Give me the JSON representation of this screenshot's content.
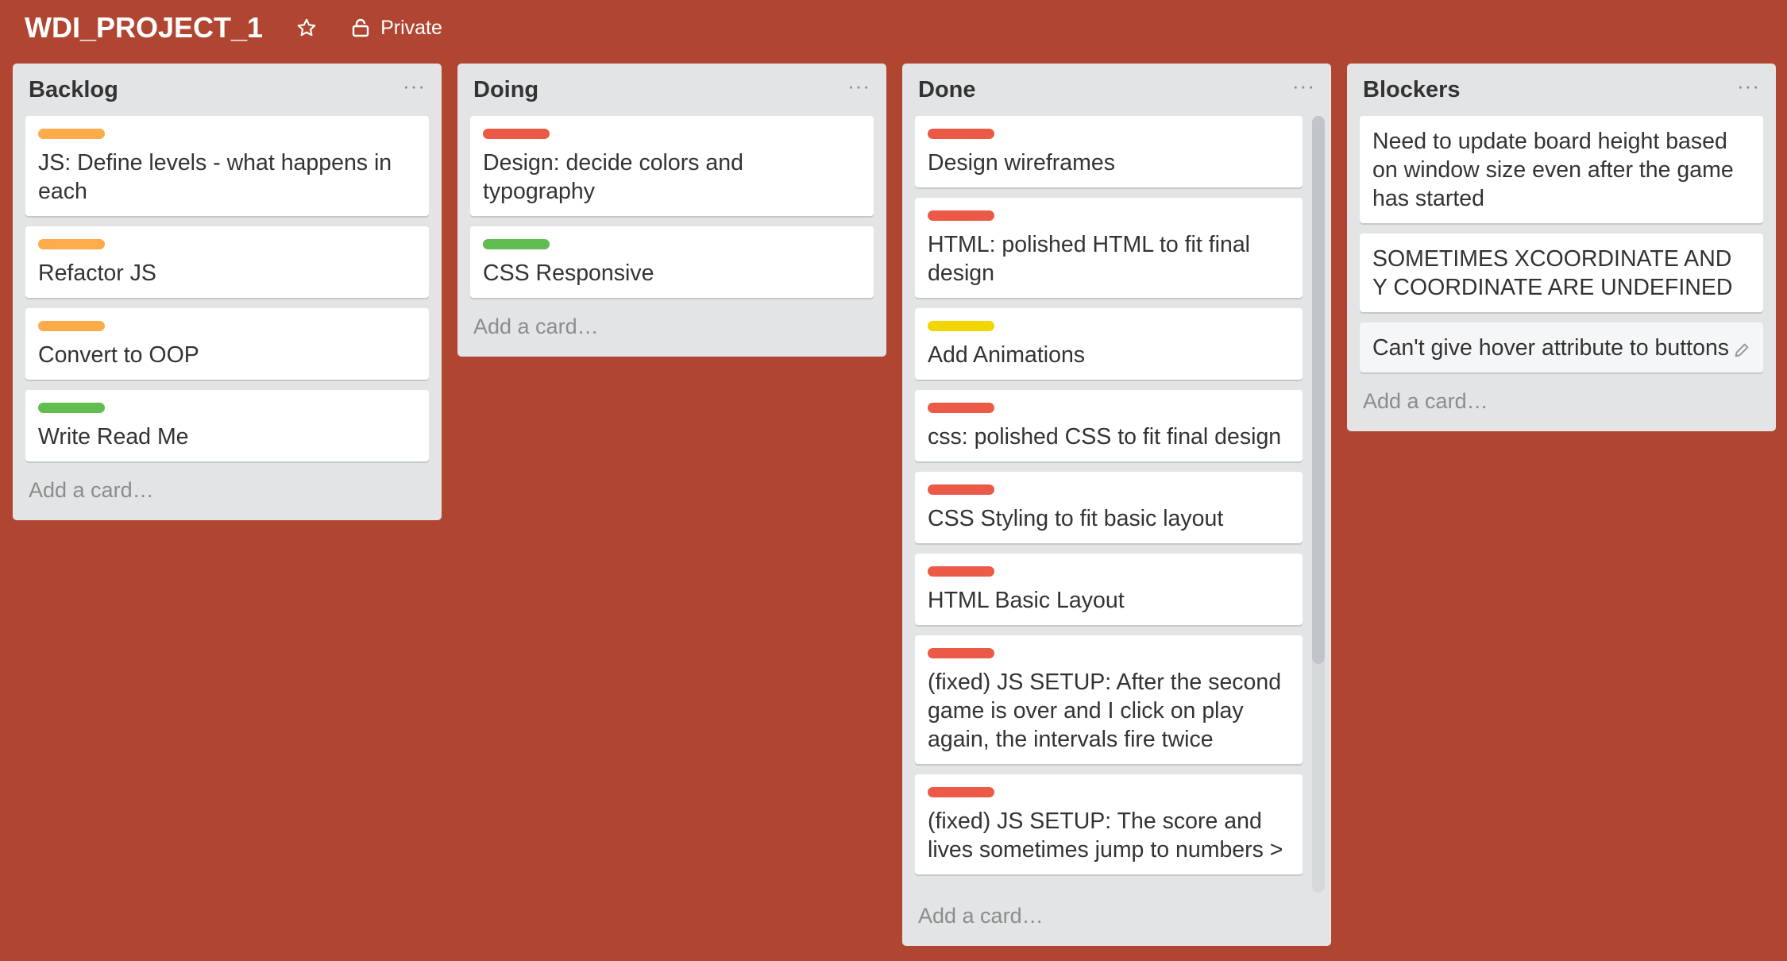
{
  "board": {
    "title": "WDI_PROJECT_1",
    "visibility": "Private",
    "star_icon": "star-icon",
    "lock_icon": "lock-icon"
  },
  "colors": {
    "background": "#b04632",
    "list_bg": "#e2e4e6",
    "orange": "#ffab4a",
    "green": "#61bd4f",
    "red": "#eb5a46",
    "yellow": "#f2d600"
  },
  "lists": [
    {
      "title": "Backlog",
      "menu": "···",
      "add_card": "Add a card…",
      "cards": [
        {
          "label": "orange",
          "title": "JS: Define levels - what happens in each"
        },
        {
          "label": "orange",
          "title": "Refactor JS"
        },
        {
          "label": "orange",
          "title": "Convert to OOP"
        },
        {
          "label": "green",
          "title": "Write Read Me"
        }
      ]
    },
    {
      "title": "Doing",
      "menu": "···",
      "add_card": "Add a card…",
      "cards": [
        {
          "label": "red",
          "title": "Design: decide colors and typography"
        },
        {
          "label": "green",
          "title": "CSS Responsive"
        }
      ]
    },
    {
      "title": "Done",
      "menu": "···",
      "add_card": "Add a card…",
      "cards": [
        {
          "label": "red",
          "title": "Design wireframes"
        },
        {
          "label": "red",
          "title": "HTML: polished HTML to fit final design"
        },
        {
          "label": "yellow",
          "title": "Add Animations"
        },
        {
          "label": "red",
          "title": "css: polished CSS to fit final design"
        },
        {
          "label": "red",
          "title": "CSS Styling to fit basic layout"
        },
        {
          "label": "red",
          "title": "HTML Basic Layout"
        },
        {
          "label": "red",
          "title": "(fixed) JS SETUP: After the second game is over and I click on play again, the intervals fire twice"
        },
        {
          "label": "red",
          "title": "(fixed) JS SETUP: The score and lives sometimes jump to numbers >"
        }
      ]
    },
    {
      "title": "Blockers",
      "menu": "···",
      "add_card": "Add a card…",
      "cards": [
        {
          "label": null,
          "title": "Need to update board height based on window size even after the game has started"
        },
        {
          "label": null,
          "title": "SOMETIMES XCOORDINATE AND Y COORDINATE ARE UNDEFINED"
        },
        {
          "label": null,
          "title": "Can't give hover attribute to buttons",
          "hover": true,
          "edit_icon": "pencil-icon"
        }
      ]
    }
  ]
}
